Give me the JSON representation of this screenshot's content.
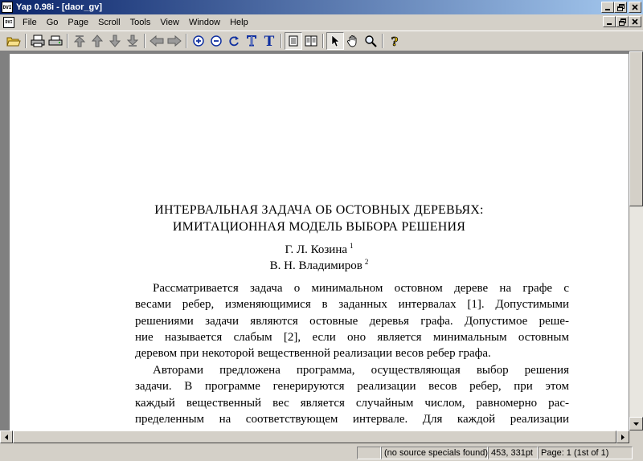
{
  "window": {
    "title": "Yap 0.98i - [daor_gv]",
    "app_icon": "dvi-icon"
  },
  "menu": {
    "items": [
      "File",
      "Go",
      "Page",
      "Scroll",
      "Tools",
      "View",
      "Window",
      "Help"
    ]
  },
  "toolbar": {
    "icons": [
      "open-folder-icon",
      "print-icon",
      "print-setup-icon",
      "first-page-icon",
      "previous-page-icon",
      "next-page-icon",
      "last-page-icon",
      "back-icon",
      "forward-icon",
      "zoom-in-icon",
      "zoom-out-icon",
      "refresh-icon",
      "hollow-t-icon",
      "bold-t-icon",
      "single-page-icon",
      "double-page-icon",
      "pointer-icon",
      "hand-icon",
      "magnifier-icon",
      "help-icon"
    ]
  },
  "document": {
    "title_line1": "ИНТЕРВАЛЬНАЯ ЗАДАЧА ОБ ОСТОВНЫХ ДЕРЕВЬЯХ:",
    "title_line2": "ИМИТАЦИОННАЯ МОДЕЛЬ ВЫБОРА РЕШЕНИЯ",
    "author1": "Г. Л. Козина",
    "author1_note": "1",
    "author2": "В. Н. Владимиров",
    "author2_note": "2",
    "para1": [
      "Рассматривается задача о минимальном остовном дереве на графе с",
      "весами ребер, изменяющимися в заданных интервалах [1]. Допустимыми",
      "решениями задачи являются остовные деревья графа. Допустимое реше-",
      "ние называется слабым [2], если оно является минимальным остовным",
      "деревом при некоторой вещественной реализации весов ребер графа."
    ],
    "para2": [
      "Авторами предложена программа, осуществляющая выбор решения",
      "задачи. В программе генерируются реализации весов ребер, при этом",
      "каждый вещественный вес является случайным числом, равномерно рас-",
      "пределенным на соответствующем интервале. Для каждой реализации"
    ]
  },
  "status": {
    "empty": "",
    "source_specials": "(no source specials found)",
    "coords": "453, 331pt",
    "page": "Page: 1 (1st of 1)"
  }
}
